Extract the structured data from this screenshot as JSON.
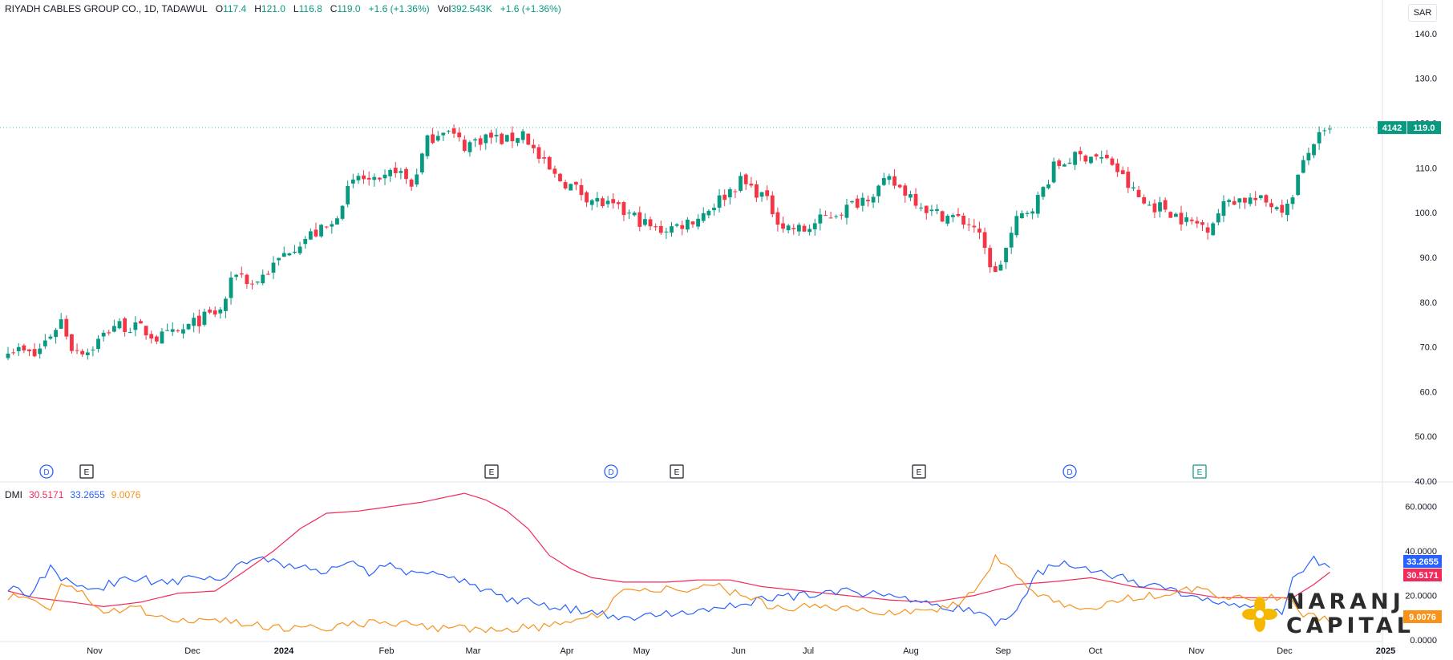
{
  "header": {
    "title": "RIYADH CABLES GROUP CO., 1D, TADAWUL",
    "o_label": "O",
    "o": "117.4",
    "h_label": "H",
    "h": "121.0",
    "l_label": "L",
    "l": "116.8",
    "c_label": "C",
    "c": "119.0",
    "change": "+1.6 (+1.36%)",
    "vol_label": "Vol",
    "vol": "392.543K",
    "vol_change": "+1.6 (+1.36%)"
  },
  "currency": "SAR",
  "logo": {
    "line1": "NARANJ",
    "line2": "CAPITAL"
  },
  "colors": {
    "up": "#089981",
    "down": "#f23645",
    "di_plus": "#2962ff",
    "di_minus": "#f7931a",
    "adx": "#f2295b",
    "grid": "#f0f3fa",
    "axis_text": "#131722"
  },
  "chart_data": [
    {
      "type": "candlestick",
      "ylim": [
        40,
        145
      ],
      "yticks": [
        "140.0",
        "130.0",
        "120.0",
        "110.0",
        "100.0",
        "90.0",
        "80.0",
        "70.0",
        "60.0",
        "50.00",
        "40.00"
      ],
      "xticks": [
        "Nov",
        "Dec",
        "2024",
        "Feb",
        "Mar",
        "Apr",
        "May",
        "Jun",
        "Jul",
        "Aug",
        "Sep",
        "Oct",
        "Nov",
        "Dec",
        "2025"
      ],
      "last_price_label": "119.0",
      "countdown_label": "4142",
      "event_markers": [
        "D",
        "E",
        "E",
        "D",
        "E",
        "E",
        "D",
        "E"
      ],
      "close_anchors": [
        [
          0,
          70
        ],
        [
          5,
          68
        ],
        [
          10,
          76
        ],
        [
          12,
          70
        ],
        [
          15,
          69
        ],
        [
          20,
          75
        ],
        [
          25,
          74
        ],
        [
          28,
          72
        ],
        [
          32,
          73
        ],
        [
          36,
          76
        ],
        [
          40,
          78
        ],
        [
          43,
          87
        ],
        [
          46,
          84
        ],
        [
          50,
          88
        ],
        [
          53,
          92
        ],
        [
          57,
          95
        ],
        [
          61,
          97
        ],
        [
          63,
          103
        ],
        [
          66,
          108
        ],
        [
          70,
          106
        ],
        [
          73,
          110
        ],
        [
          76,
          106
        ],
        [
          79,
          116
        ],
        [
          82,
          119
        ],
        [
          86,
          115
        ],
        [
          90,
          117
        ],
        [
          94,
          116
        ],
        [
          97,
          118
        ],
        [
          100,
          112
        ],
        [
          103,
          108
        ],
        [
          106,
          106
        ],
        [
          110,
          103
        ],
        [
          114,
          101
        ],
        [
          118,
          99
        ],
        [
          122,
          96
        ],
        [
          126,
          97
        ],
        [
          130,
          99
        ],
        [
          134,
          103
        ],
        [
          138,
          107
        ],
        [
          142,
          104
        ],
        [
          146,
          97
        ],
        [
          150,
          96
        ],
        [
          154,
          99
        ],
        [
          158,
          101
        ],
        [
          162,
          104
        ],
        [
          166,
          107
        ],
        [
          170,
          104
        ],
        [
          174,
          100
        ],
        [
          178,
          99
        ],
        [
          182,
          97
        ],
        [
          186,
          86
        ],
        [
          190,
          98
        ],
        [
          194,
          103
        ],
        [
          197,
          110
        ],
        [
          200,
          112
        ],
        [
          204,
          113
        ],
        [
          208,
          111
        ],
        [
          211,
          106
        ],
        [
          214,
          102
        ],
        [
          218,
          101
        ],
        [
          222,
          98
        ],
        [
          226,
          97
        ],
        [
          230,
          103
        ],
        [
          234,
          103
        ],
        [
          238,
          102
        ],
        [
          241,
          101
        ],
        [
          243,
          108
        ],
        [
          246,
          116
        ],
        [
          249,
          118
        ]
      ],
      "gap_after_index": 241
    },
    {
      "type": "line",
      "title": "DMI",
      "values_label": [
        "30.5171",
        "33.2655",
        "9.0076"
      ],
      "ylim": [
        0,
        70
      ],
      "yticks": [
        "60.0000",
        "40.0000",
        "20.0000",
        "0.0000"
      ],
      "series": [
        {
          "color_key": "adx",
          "last": "30.5171",
          "anchors": [
            [
              0,
              22
            ],
            [
              5,
              19
            ],
            [
              12,
              17
            ],
            [
              18,
              15
            ],
            [
              25,
              17
            ],
            [
              32,
              21
            ],
            [
              39,
              22
            ],
            [
              44,
              30
            ],
            [
              50,
              40
            ],
            [
              55,
              50
            ],
            [
              60,
              57
            ],
            [
              66,
              58
            ],
            [
              72,
              60
            ],
            [
              78,
              62
            ],
            [
              82,
              64
            ],
            [
              86,
              66
            ],
            [
              90,
              63
            ],
            [
              94,
              58
            ],
            [
              98,
              50
            ],
            [
              102,
              38
            ],
            [
              106,
              32
            ],
            [
              110,
              28
            ],
            [
              116,
              26
            ],
            [
              124,
              26
            ],
            [
              130,
              27
            ],
            [
              136,
              27
            ],
            [
              142,
              24
            ],
            [
              150,
              22
            ],
            [
              158,
              20
            ],
            [
              166,
              18
            ],
            [
              174,
              17
            ],
            [
              182,
              20
            ],
            [
              190,
              25
            ],
            [
              196,
              26
            ],
            [
              204,
              28
            ],
            [
              212,
              24
            ],
            [
              220,
              22
            ],
            [
              228,
              19
            ],
            [
              236,
              19
            ],
            [
              242,
              19
            ],
            [
              246,
              25
            ],
            [
              249,
              30.5
            ]
          ]
        },
        {
          "color_key": "di_plus",
          "last": "33.2655",
          "anchors": [
            [
              0,
              24
            ],
            [
              4,
              21
            ],
            [
              8,
              32
            ],
            [
              12,
              24
            ],
            [
              16,
              22
            ],
            [
              20,
              26
            ],
            [
              24,
              28
            ],
            [
              28,
              26
            ],
            [
              34,
              27
            ],
            [
              40,
              27
            ],
            [
              44,
              34
            ],
            [
              48,
              38
            ],
            [
              52,
              34
            ],
            [
              56,
              32
            ],
            [
              60,
              30
            ],
            [
              64,
              35
            ],
            [
              68,
              30
            ],
            [
              72,
              34
            ],
            [
              76,
              30
            ],
            [
              80,
              32
            ],
            [
              84,
              28
            ],
            [
              88,
              24
            ],
            [
              92,
              20
            ],
            [
              96,
              18
            ],
            [
              100,
              16
            ],
            [
              106,
              14
            ],
            [
              112,
              12
            ],
            [
              118,
              10
            ],
            [
              124,
              12
            ],
            [
              130,
              14
            ],
            [
              136,
              16
            ],
            [
              142,
              18
            ],
            [
              150,
              20
            ],
            [
              158,
              22
            ],
            [
              164,
              20
            ],
            [
              170,
              18
            ],
            [
              176,
              16
            ],
            [
              182,
              12
            ],
            [
              186,
              8
            ],
            [
              190,
              14
            ],
            [
              194,
              30
            ],
            [
              198,
              34
            ],
            [
              204,
              32
            ],
            [
              210,
              28
            ],
            [
              216,
              24
            ],
            [
              222,
              20
            ],
            [
              228,
              16
            ],
            [
              234,
              14
            ],
            [
              240,
              12
            ],
            [
              242,
              28
            ],
            [
              246,
              36
            ],
            [
              249,
              33.3
            ]
          ]
        },
        {
          "color_key": "di_minus",
          "last": "9.0076",
          "anchors": [
            [
              0,
              20
            ],
            [
              4,
              18
            ],
            [
              8,
              14
            ],
            [
              10,
              26
            ],
            [
              14,
              22
            ],
            [
              18,
              12
            ],
            [
              24,
              14
            ],
            [
              30,
              10
            ],
            [
              36,
              9
            ],
            [
              42,
              8
            ],
            [
              48,
              6
            ],
            [
              54,
              5
            ],
            [
              60,
              6
            ],
            [
              66,
              7
            ],
            [
              72,
              8
            ],
            [
              78,
              6
            ],
            [
              84,
              5
            ],
            [
              90,
              5
            ],
            [
              96,
              5
            ],
            [
              100,
              6
            ],
            [
              106,
              9
            ],
            [
              112,
              12
            ],
            [
              116,
              22
            ],
            [
              120,
              24
            ],
            [
              126,
              22
            ],
            [
              132,
              26
            ],
            [
              136,
              22
            ],
            [
              140,
              18
            ],
            [
              146,
              14
            ],
            [
              152,
              16
            ],
            [
              158,
              14
            ],
            [
              164,
              12
            ],
            [
              170,
              12
            ],
            [
              176,
              14
            ],
            [
              180,
              18
            ],
            [
              184,
              28
            ],
            [
              186,
              38
            ],
            [
              190,
              30
            ],
            [
              194,
              20
            ],
            [
              198,
              16
            ],
            [
              204,
              14
            ],
            [
              210,
              18
            ],
            [
              216,
              20
            ],
            [
              222,
              24
            ],
            [
              228,
              20
            ],
            [
              234,
              18
            ],
            [
              240,
              20
            ],
            [
              244,
              12
            ],
            [
              249,
              9
            ]
          ]
        }
      ]
    }
  ]
}
